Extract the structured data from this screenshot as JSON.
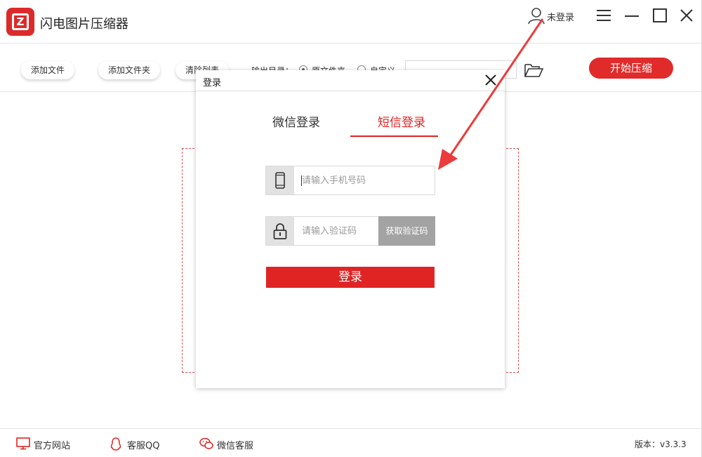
{
  "app": {
    "title": "闪电图片压缩器",
    "logo_letter": "Z"
  },
  "user": {
    "status": "未登录",
    "icon": "user-icon"
  },
  "window_controls": [
    "menu-icon",
    "minimize-icon",
    "maximize-icon",
    "close-icon"
  ],
  "toolbar": {
    "add_file": "添加文件",
    "add_folder": "添加文件夹",
    "clear_list": "清除列表",
    "output_label": "输出目录：",
    "output_original": "原文件夹",
    "output_custom": "自定义",
    "selected_output": "原文件夹",
    "path_value": "",
    "start": "开始压缩"
  },
  "dialog": {
    "title": "登录",
    "tabs": [
      {
        "label": "微信登录",
        "active": false
      },
      {
        "label": "短信登录",
        "active": true
      }
    ],
    "phone_placeholder": "请输入手机号码",
    "code_placeholder": "请输入验证码",
    "get_code": "获取验证码",
    "submit": "登录"
  },
  "footer": {
    "website": "官方网站",
    "qq": "客服QQ",
    "wechat": "微信客服",
    "version": "版本：v3.3.3"
  },
  "colors": {
    "accent": "#e02424",
    "annotation_arrow": "#ec3b3b"
  }
}
